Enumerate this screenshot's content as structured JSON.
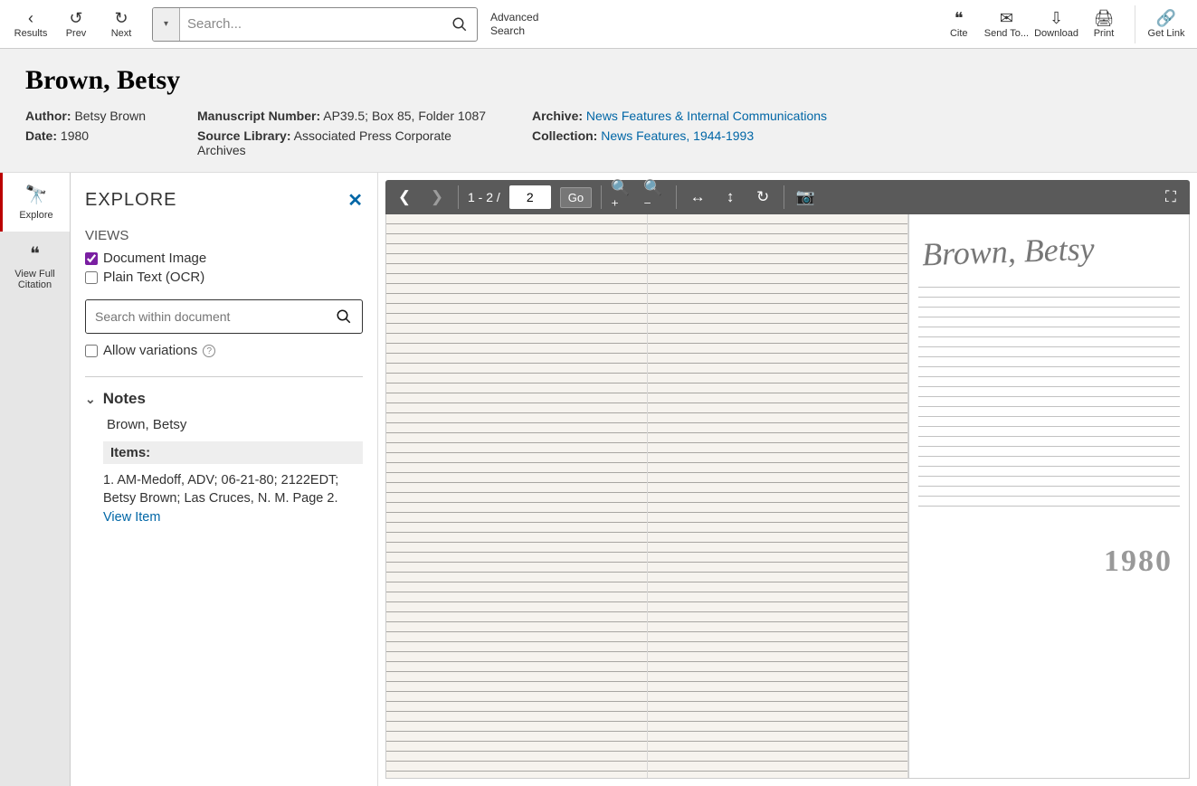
{
  "topbar": {
    "results": "Results",
    "prev": "Prev",
    "next": "Next",
    "search_placeholder": "Search...",
    "advanced_line1": "Advanced",
    "advanced_line2": "Search",
    "cite": "Cite",
    "sendto": "Send To...",
    "download": "Download",
    "print": "Print",
    "getlink": "Get Link"
  },
  "meta": {
    "title": "Brown, Betsy",
    "author_lbl": "Author:",
    "author": "Betsy Brown",
    "mnum_lbl": "Manuscript Number:",
    "mnum": "AP39.5; Box 85, Folder 1087",
    "archive_lbl": "Archive:",
    "archive": "News Features & Internal Communications",
    "date_lbl": "Date:",
    "date": "1980",
    "srclib_lbl": "Source Library:",
    "srclib": "Associated Press Corporate Archives",
    "coll_lbl": "Collection:",
    "coll": "News Features, 1944-1993"
  },
  "rail": {
    "explore": "Explore",
    "citation_l1": "View Full",
    "citation_l2": "Citation"
  },
  "panel": {
    "title": "EXPLORE",
    "views": "VIEWS",
    "doc_image": "Document Image",
    "plain_text": "Plain Text (OCR)",
    "swd_placeholder": "Search within document",
    "allow_var": "Allow variations",
    "notes": "Notes",
    "note_line": "Brown, Betsy",
    "items": "Items:",
    "item_text": "1. AM-Medoff, ADV; 06-21-80; 2122EDT; Betsy Brown; Las Cruces, N. M. Page 2.",
    "view_item": "View Item"
  },
  "viewer": {
    "page_range": "1 - 2 /",
    "total_pages": "2",
    "current_page": "2",
    "go": "Go",
    "signature": "Brown, Betsy",
    "year_stamp": "1980"
  }
}
